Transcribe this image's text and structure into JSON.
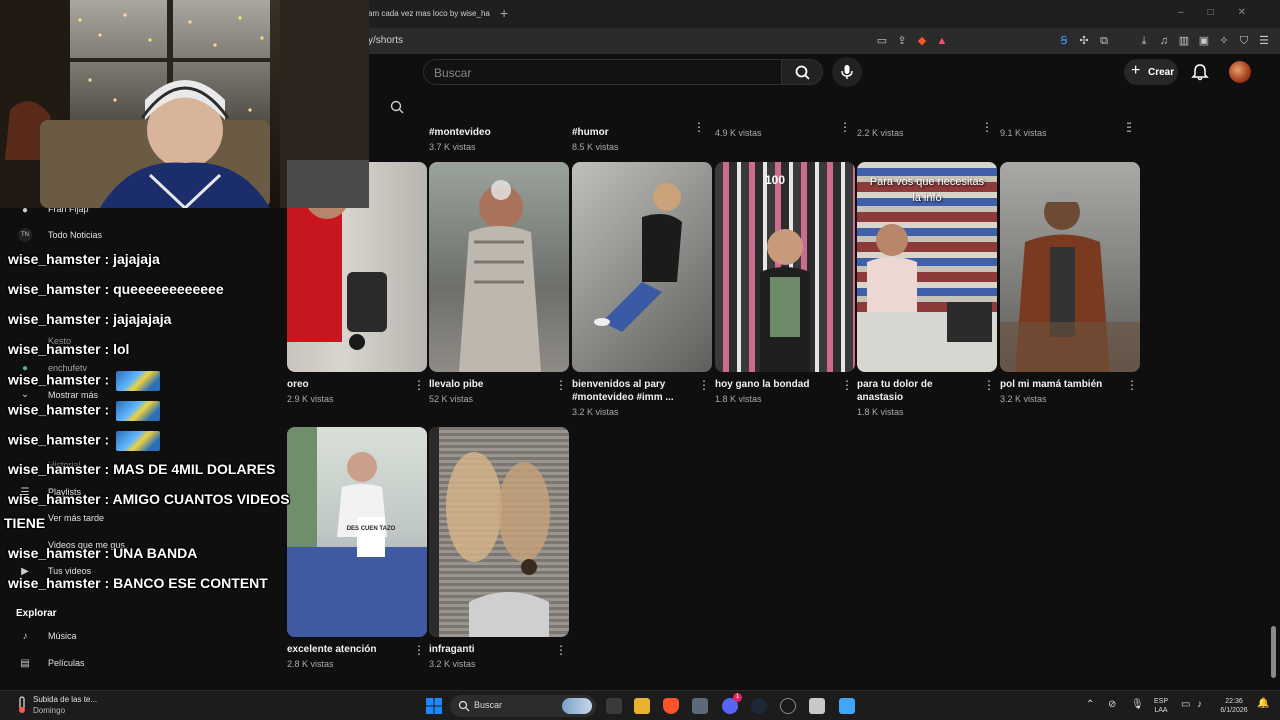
{
  "browser": {
    "tab_title": "am cada vez mas loco by wise_ha",
    "new_tab": "+",
    "url": "y/shorts"
  },
  "header": {
    "search_placeholder": "Buscar",
    "create_label": "Crear"
  },
  "top_row": [
    {
      "title": "#montevideo",
      "views": "3.7 K vistas"
    },
    {
      "title": "#humor",
      "views": "8.5 K vistas"
    },
    {
      "title": "",
      "views": "4.9 K vistas"
    },
    {
      "title": "",
      "views": "2.2 K vistas"
    },
    {
      "title": "",
      "views": "9.1 K vistas"
    }
  ],
  "videos": [
    {
      "title": "oreo",
      "views": "2.9 K vistas",
      "overlay": ""
    },
    {
      "title": "llevalo pibe",
      "views": "52 K vistas",
      "overlay": ""
    },
    {
      "title": "bienvenidos al pary #montevideo #imm ...",
      "views": "3.2 K vistas",
      "overlay": ""
    },
    {
      "title": "hoy gano la bondad",
      "views": "1.8 K vistas",
      "overlay": "100"
    },
    {
      "title": "para tu dolor de anastasio",
      "views": "1.8 K vistas",
      "overlay": "Para vos que necesitas la info"
    },
    {
      "title": "pol mi mamá también",
      "views": "3.2 K vistas",
      "overlay": ""
    },
    {
      "title": "excelente atención",
      "views": "2.8 K vistas",
      "overlay": "DES CUEN TAZO"
    },
    {
      "title": "infraganti",
      "views": "3.2 K vistas",
      "overlay": ""
    }
  ],
  "sidebar": {
    "items": [
      {
        "label": "Fran Fijap",
        "icon": "avatar"
      },
      {
        "label": "Todo Noticias",
        "icon": "tn-logo"
      },
      {
        "label": "Mostrar más",
        "icon": "chevron-down"
      },
      {
        "label": "Kesto",
        "icon": "x"
      },
      {
        "label": "enchufetv",
        "icon": "avatar"
      },
      {
        "label": "Historial",
        "icon": "history"
      },
      {
        "label": "Playlists",
        "icon": "playlist"
      },
      {
        "label": "Ver más tarde",
        "icon": "clock"
      },
      {
        "label": "Videos que me gus",
        "icon": "like"
      },
      {
        "label": "Tus videos",
        "icon": "video"
      }
    ],
    "explore_heading": "Explorar",
    "explore_items": [
      {
        "label": "Música",
        "icon": "music-note"
      },
      {
        "label": "Películas",
        "icon": "film"
      }
    ]
  },
  "chat": {
    "messages": [
      {
        "user": "wise_hamster",
        "text": "jajajaja"
      },
      {
        "user": "wise_hamster",
        "text": "queeeeeeeeeeee"
      },
      {
        "user": "wise_hamster",
        "text": "jajajajaja"
      },
      {
        "user": "wise_hamster",
        "text": "lol"
      },
      {
        "user": "wise_hamster",
        "text": "",
        "emote": true
      },
      {
        "user": "wise_hamster",
        "text": "",
        "emote": true
      },
      {
        "user": "wise_hamster",
        "text": "",
        "emote": true
      },
      {
        "user": "wise_hamster",
        "text": "MAS DE 4MIL DOLARES"
      },
      {
        "user": "wise_hamster",
        "text": "AMIGO CUANTOS VIDEOS"
      },
      {
        "user": "",
        "text": "TIENE"
      },
      {
        "user": "wise_hamster",
        "text": "UNA BANDA"
      },
      {
        "user": "wise_hamster",
        "text": "BANCO ESE CONTENT"
      }
    ],
    "separator": " : "
  },
  "taskbar": {
    "weather_title": "Subida de las te...",
    "weather_sub": "Domingo",
    "search_label": "Buscar",
    "lang_line1": "ESP",
    "lang_line2": "LAA",
    "time": "22:36",
    "date": "6/1/2026",
    "notif_badge": "1"
  },
  "colors": {
    "background": "#0f0f0f",
    "chat_text": "#ffffff",
    "views_text": "#aaaaaa",
    "windows_accent": "#1e88ff",
    "brave": "#fb542b"
  }
}
